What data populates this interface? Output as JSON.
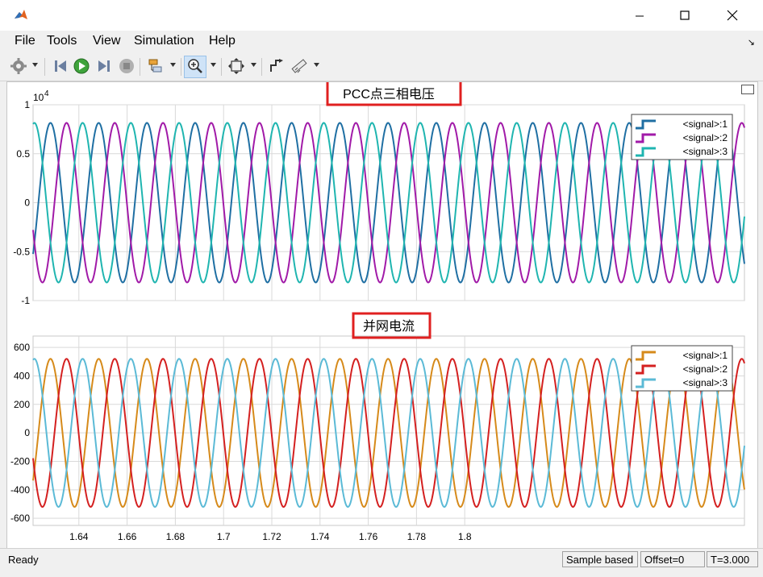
{
  "menus": [
    "File",
    "Tools",
    "View",
    "Simulation",
    "Help"
  ],
  "status": {
    "text": "Ready",
    "mode": "Sample based",
    "offset": "Offset=0",
    "time": "T=3.000"
  },
  "toolbar_icons": [
    "settings-icon",
    "step-back-icon",
    "run-icon",
    "step-forward-icon",
    "stop-icon",
    "layout-icon",
    "zoom-icon",
    "fit-icon",
    "cursor-icon",
    "measure-icon"
  ],
  "colors": {
    "voltage": [
      "#1f6fa3",
      "#a11aa8",
      "#1fb5b0"
    ],
    "current": [
      "#d68a1a",
      "#d42020",
      "#5bbad6"
    ],
    "highlight": "#e02020"
  },
  "chart_data": [
    {
      "type": "line",
      "title": "PCC点三相电压",
      "exponent_label": "10",
      "exponent_power": "4",
      "xlim": [
        1.621,
        1.916
      ],
      "ylim": [
        -1,
        1
      ],
      "yticks": [
        1,
        0.5,
        0,
        -0.5,
        -1
      ],
      "ytick_labels": [
        "1",
        "0.5",
        "0",
        "-0.5",
        "-1"
      ],
      "xticks": [
        1.64,
        1.66,
        1.68,
        1.7,
        1.72,
        1.74,
        1.76,
        1.78,
        1.8
      ],
      "grid": true,
      "legend_position": "top-right",
      "series_form": "sinusoid",
      "frequency_hz": 50,
      "amplitude": 0.815,
      "series": [
        {
          "name": "<signal>:1",
          "phase_deg": 0
        },
        {
          "name": "<signal>:2",
          "phase_deg": -120
        },
        {
          "name": "<signal>:3",
          "phase_deg": 120
        }
      ]
    },
    {
      "type": "line",
      "title": "并网电流",
      "xlim": [
        1.621,
        1.916
      ],
      "ylim": [
        -650,
        680
      ],
      "yticks": [
        600,
        400,
        200,
        0,
        -200,
        -400,
        -600
      ],
      "ytick_labels": [
        "600",
        "400",
        "200",
        "0",
        "-200",
        "-400",
        "-600"
      ],
      "xticks": [
        1.64,
        1.66,
        1.68,
        1.7,
        1.72,
        1.74,
        1.76,
        1.78,
        1.8
      ],
      "xtick_labels": [
        "1.64",
        "1.66",
        "1.68",
        "1.7",
        "1.72",
        "1.74",
        "1.76",
        "1.78",
        "1.8"
      ],
      "grid": true,
      "legend_position": "top-right",
      "series_form": "sinusoid",
      "frequency_hz": 50,
      "amplitude": 520,
      "series": [
        {
          "name": "<signal>:1",
          "phase_deg": 0
        },
        {
          "name": "<signal>:2",
          "phase_deg": -120
        },
        {
          "name": "<signal>:3",
          "phase_deg": 120
        }
      ]
    }
  ]
}
